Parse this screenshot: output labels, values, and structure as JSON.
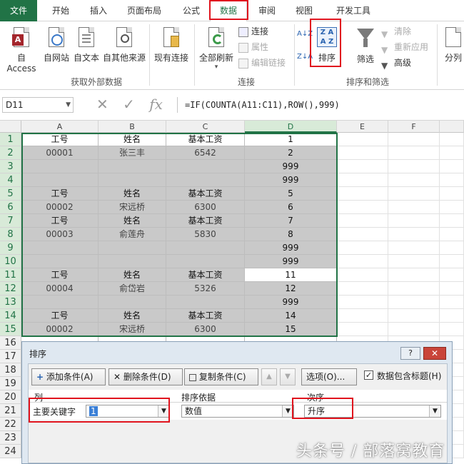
{
  "menu": {
    "tabs": [
      "文件",
      "开始",
      "插入",
      "页面布局",
      "公式",
      "数据",
      "审阅",
      "视图",
      "开发工具"
    ],
    "active": "数据"
  },
  "ribbon": {
    "external": {
      "access": "自 Access",
      "web": "自网站",
      "text": "自文本",
      "other": "自其他来源",
      "existing": "现有连接",
      "group": "获取外部数据"
    },
    "connections": {
      "refresh_all": "全部刷新",
      "connect": "连接",
      "properties": "属性",
      "edit_links": "编辑链接",
      "group": "连接"
    },
    "sort_filter": {
      "az": "A↓Z",
      "za": "Z↓A",
      "sort": "排序",
      "filter": "筛选",
      "clear": "清除",
      "reapply": "重新应用",
      "advanced": "高级",
      "group": "排序和筛选"
    },
    "split": "分列"
  },
  "formula_bar": {
    "name_box": "D11",
    "cancel_icon": "✕",
    "enter_icon": "✓",
    "fx_icon": "fx",
    "formula": "=IF(COUNTA(A11:C11),ROW(),999)"
  },
  "sheet": {
    "columns": [
      "A",
      "B",
      "C",
      "D",
      "E",
      "F"
    ],
    "rows": [
      {
        "n": "1",
        "a": "工号",
        "b": "姓名",
        "c": "基本工资",
        "d": "1"
      },
      {
        "n": "2",
        "a": "00001",
        "b": "张三丰",
        "c": "6542",
        "d": "2"
      },
      {
        "n": "3",
        "a": "",
        "b": "",
        "c": "",
        "d": "999"
      },
      {
        "n": "4",
        "a": "",
        "b": "",
        "c": "",
        "d": "999"
      },
      {
        "n": "5",
        "a": "工号",
        "b": "姓名",
        "c": "基本工资",
        "d": "5"
      },
      {
        "n": "6",
        "a": "00002",
        "b": "宋远桥",
        "c": "6300",
        "d": "6"
      },
      {
        "n": "7",
        "a": "工号",
        "b": "姓名",
        "c": "基本工资",
        "d": "7"
      },
      {
        "n": "8",
        "a": "00003",
        "b": "俞莲舟",
        "c": "5830",
        "d": "8"
      },
      {
        "n": "9",
        "a": "",
        "b": "",
        "c": "",
        "d": "999"
      },
      {
        "n": "10",
        "a": "",
        "b": "",
        "c": "",
        "d": "999"
      },
      {
        "n": "11",
        "a": "工号",
        "b": "姓名",
        "c": "基本工资",
        "d": "11"
      },
      {
        "n": "12",
        "a": "00004",
        "b": "俞岱岩",
        "c": "5326",
        "d": "12"
      },
      {
        "n": "13",
        "a": "",
        "b": "",
        "c": "",
        "d": "999"
      },
      {
        "n": "14",
        "a": "工号",
        "b": "姓名",
        "c": "基本工资",
        "d": "14"
      },
      {
        "n": "15",
        "a": "00002",
        "b": "宋远桥",
        "c": "6300",
        "d": "15"
      },
      {
        "n": "16",
        "a": "",
        "b": "",
        "c": "",
        "d": ""
      },
      {
        "n": "17",
        "a": "",
        "b": "",
        "c": "",
        "d": ""
      },
      {
        "n": "18",
        "a": "",
        "b": "",
        "c": "",
        "d": ""
      },
      {
        "n": "19",
        "a": "",
        "b": "",
        "c": "",
        "d": ""
      },
      {
        "n": "20",
        "a": "",
        "b": "",
        "c": "",
        "d": ""
      },
      {
        "n": "21",
        "a": "",
        "b": "",
        "c": "",
        "d": ""
      },
      {
        "n": "22",
        "a": "",
        "b": "",
        "c": "",
        "d": ""
      },
      {
        "n": "23",
        "a": "",
        "b": "",
        "c": "",
        "d": ""
      },
      {
        "n": "24",
        "a": "",
        "b": "",
        "c": "",
        "d": ""
      }
    ]
  },
  "dialog": {
    "title": "排序",
    "help": "?",
    "close": "✕",
    "add_level": "添加条件(A)",
    "delete_level": "删除条件(D)",
    "copy_level": "复制条件(C)",
    "up": "▲",
    "down": "▼",
    "options": "选项(O)...",
    "has_headers": "数据包含标题(H)",
    "col_header": "列",
    "sort_on_header": "排序依据",
    "order_header": "次序",
    "key_label": "主要关键字",
    "key_value": "1",
    "sort_on_value": "数值",
    "order_value": "升序"
  },
  "watermark": "头条号 / 部落窝教育",
  "colors": {
    "accent": "#217346",
    "highlight": "#e0141e",
    "gray_fill": "#c9c9c9"
  }
}
